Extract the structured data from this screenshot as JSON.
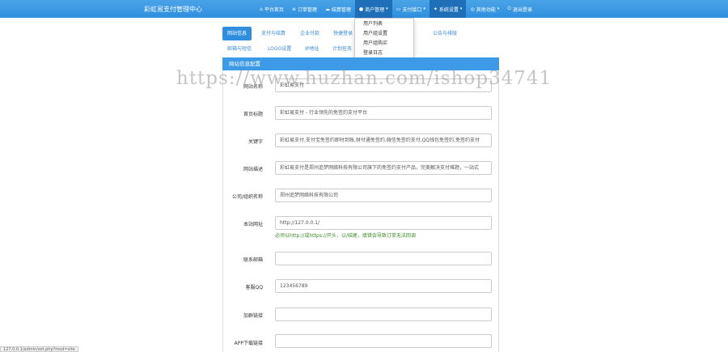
{
  "app": {
    "title": "彩虹易支付管理中心"
  },
  "nav": [
    {
      "icon": "home-icon",
      "glyph": "⌂",
      "label": "平台首页",
      "caret": false
    },
    {
      "icon": "list-icon",
      "glyph": "≡",
      "label": "订单管理",
      "caret": false
    },
    {
      "icon": "cloud-icon",
      "glyph": "☁",
      "label": "结算管理",
      "caret": false
    },
    {
      "icon": "user-icon",
      "glyph": "●",
      "label": "商户管理",
      "caret": true
    },
    {
      "icon": "card-icon",
      "glyph": "▭",
      "label": "支付接口",
      "caret": true
    },
    {
      "icon": "gear-icon",
      "glyph": "✦",
      "label": "系统设置",
      "caret": true
    },
    {
      "icon": "globe-icon",
      "glyph": "◎",
      "label": "其他功能",
      "caret": true
    },
    {
      "icon": "power-icon",
      "glyph": "⏻",
      "label": "退出登录",
      "caret": false
    }
  ],
  "dropdown": [
    "用户列表",
    "用户组设置",
    "用户组购买",
    "登录日志"
  ],
  "tabs": [
    "网站信息",
    "支付与结算",
    "企业付款",
    "快捷登录",
    "",
    "",
    "",
    "公告与排版",
    "邮箱与短信",
    "LOGO设置",
    "IP地址",
    "计划任务"
  ],
  "panel_title": "网站信息配置",
  "fields": [
    {
      "label": "网站名称",
      "value": "彩虹易支付"
    },
    {
      "label": "首页标题",
      "value": "彩虹易支付 - 行业领先的免签约支付平台"
    },
    {
      "label": "关键字",
      "value": "彩虹易支付,支付宝免签约即时到账,财付通免签约,微信免签约支付,QQ钱包免签约,免签约支付"
    },
    {
      "label": "网站描述",
      "value": "彩虹易支付是郑州追梦网络科技有限公司旗下的免签约支付产品，完美解决支付难题，一站式"
    },
    {
      "label": "公司/组织名称",
      "value": "郑州追梦网络科技有限公司"
    },
    {
      "label": "本站网址",
      "value": "http://127.0.0.1/"
    },
    {
      "label": "联系邮箱",
      "value": ""
    },
    {
      "label": "客服QQ",
      "value": "123456789"
    },
    {
      "label": "加群链接",
      "value": ""
    },
    {
      "label": "APP下载链接",
      "value": ""
    }
  ],
  "hint": "必须以http://或https://开头，以/结尾，填错会导致订单无法回调",
  "watermark": "https://www.huzhan.com/ishop34741",
  "status_url": "127.0.0.1/admin/set.php?mod=site"
}
